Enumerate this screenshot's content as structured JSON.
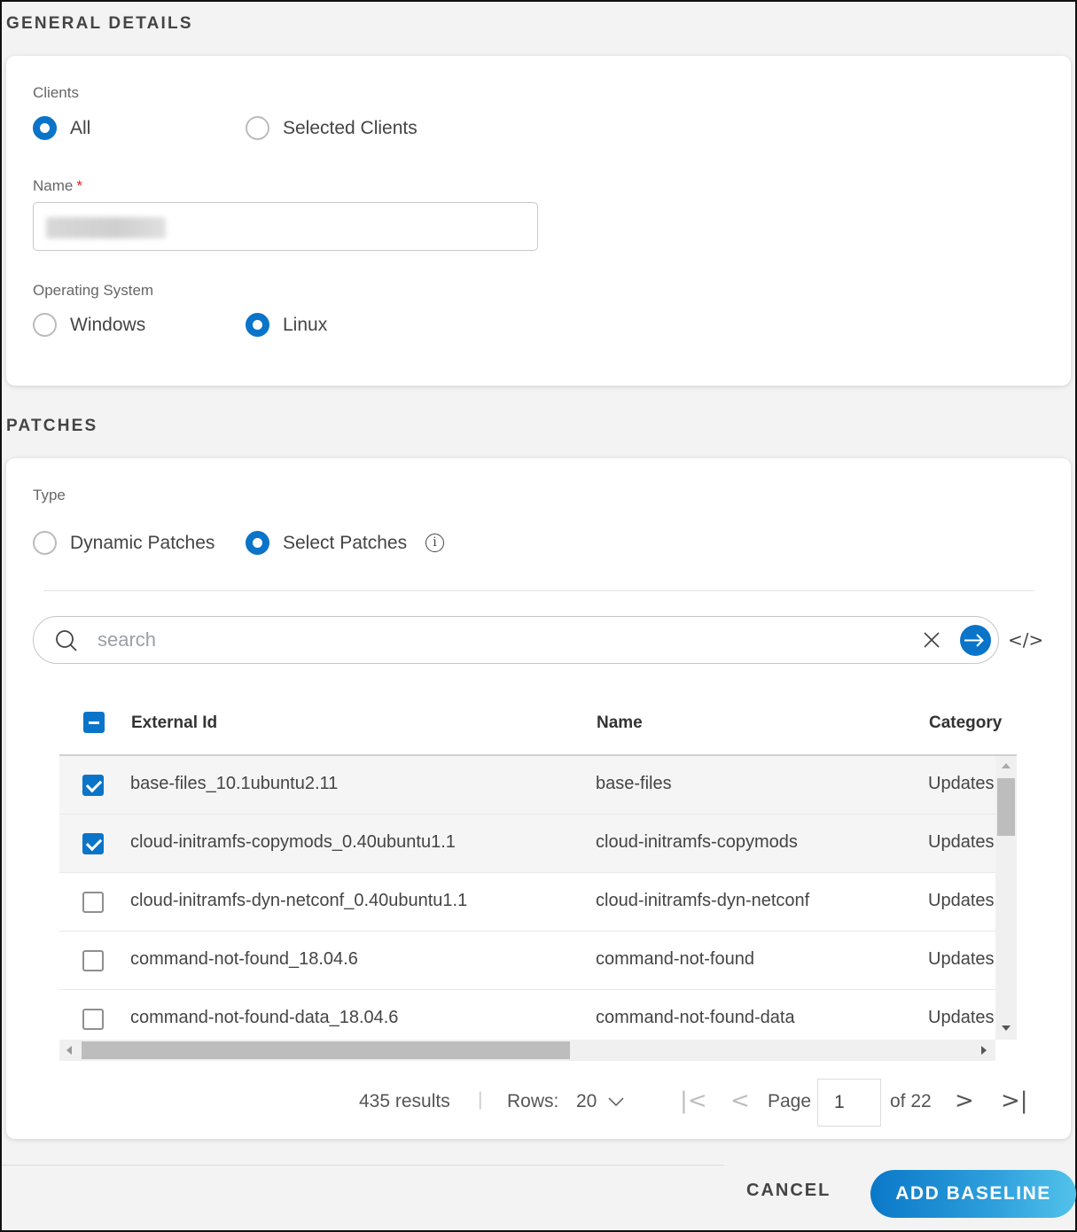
{
  "general": {
    "section_title": "GENERAL DETAILS",
    "clients_label": "Clients",
    "clients_options": [
      {
        "label": "All",
        "selected": true
      },
      {
        "label": "Selected Clients",
        "selected": false
      }
    ],
    "name_label": "Name",
    "name_required_mark": "*",
    "name_value": "",
    "os_label": "Operating System",
    "os_options": [
      {
        "label": "Windows",
        "selected": false
      },
      {
        "label": "Linux",
        "selected": true
      }
    ]
  },
  "patches": {
    "section_title": "PATCHES",
    "type_label": "Type",
    "type_options": [
      {
        "label": "Dynamic Patches",
        "selected": false
      },
      {
        "label": "Select Patches",
        "selected": true
      }
    ],
    "info_icon": "info-icon",
    "search": {
      "placeholder": "search",
      "value": "",
      "clear_icon": "close-icon",
      "submit_icon": "arrow-right-icon",
      "code_icon": "code-icon",
      "code_glyph": "</>"
    },
    "table": {
      "select_all_state": "partial",
      "columns": [
        "External Id",
        "Name",
        "Category"
      ],
      "rows": [
        {
          "checked": true,
          "external_id": "base-files_10.1ubuntu2.11",
          "name": "base-files",
          "category": "Updates"
        },
        {
          "checked": true,
          "external_id": "cloud-initramfs-copymods_0.40ubuntu1.1",
          "name": "cloud-initramfs-copymods",
          "category": "Updates"
        },
        {
          "checked": false,
          "external_id": "cloud-initramfs-dyn-netconf_0.40ubuntu1.1",
          "name": "cloud-initramfs-dyn-netconf",
          "category": "Updates"
        },
        {
          "checked": false,
          "external_id": "command-not-found_18.04.6",
          "name": "command-not-found",
          "category": "Updates"
        },
        {
          "checked": false,
          "external_id": "command-not-found-data_18.04.6",
          "name": "command-not-found-data",
          "category": "Updates"
        }
      ]
    },
    "pagination": {
      "results": "435 results",
      "separator": "|",
      "rows_label": "Rows:",
      "rows_value": "20",
      "page_label": "Page",
      "page_value": "1",
      "of_label": "of 22",
      "first_glyph": "|<",
      "prev_glyph": "<",
      "next_glyph": ">",
      "last_glyph": ">|"
    }
  },
  "footer": {
    "cancel_label": "CANCEL",
    "add_label": "ADD BASELINE"
  },
  "colors": {
    "accent": "#0a74c9",
    "required": "#e02020"
  }
}
